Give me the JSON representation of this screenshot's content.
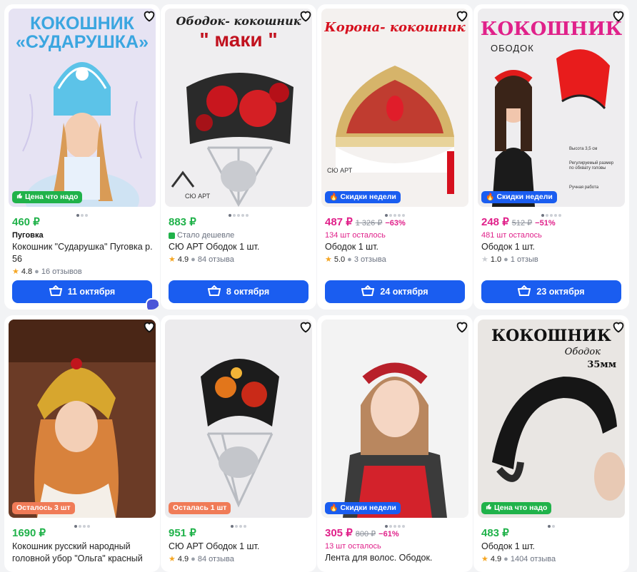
{
  "products": [
    {
      "badge": "Цена что надо",
      "badge_color": "#20b24a",
      "badge_icon": "thumb-up-icon",
      "price": "460 ₽",
      "old_price": "",
      "discount": "",
      "price_color": "#20b24a",
      "sub": "Пуговка",
      "sub_type": "bold",
      "title": "Кокошник \"Сударушка\" Пуговка р. 56",
      "rating": "4.8",
      "reviews": "16 отзывов",
      "delivery": "11 октября",
      "image": {
        "headline": "КОКОШНИК «СУДАРУШКА»",
        "headline_color": "#3ba6e0",
        "bg": "#e6e3f3"
      }
    },
    {
      "badge": "",
      "badge_color": "",
      "badge_icon": "",
      "price": "883 ₽",
      "old_price": "",
      "discount": "",
      "price_color": "#20b24a",
      "sub": "Стало дешевле",
      "sub_type": "gray",
      "title": "СЮ АРТ Ободок 1 шт.",
      "rating": "4.9",
      "reviews": "84 отзыва",
      "delivery": "8 октября",
      "image": {
        "headline": "Ободок- кокошник",
        "headline2": "\" маки \"",
        "headline_color": "#c1121f",
        "bg": "#efeef0",
        "brand": "СЮ АРТ"
      }
    },
    {
      "badge": "Скидки недели",
      "badge_color": "#1a5df0",
      "badge_icon": "fire-icon",
      "price": "487 ₽",
      "old_price": "1 326 ₽",
      "discount": "−63%",
      "price_color": "#e0218a",
      "sub": "134 шт осталось",
      "sub_type": "pink",
      "title": "Ободок 1 шт.",
      "rating": "5.0",
      "reviews": "3 отзыва",
      "delivery": "24 октября",
      "image": {
        "headline": "Корона- кокошник",
        "headline_color": "#d6101e",
        "bg": "#f4f1ef",
        "brand": "СЮ АРТ"
      }
    },
    {
      "badge": "Скидки недели",
      "badge_color": "#1a5df0",
      "badge_icon": "fire-icon",
      "price": "248 ₽",
      "old_price": "512 ₽",
      "discount": "−51%",
      "price_color": "#e0218a",
      "sub": "481 шт осталось",
      "sub_type": "pink",
      "title": "Ободок 1 шт.",
      "rating": "1.0",
      "reviews": "1 отзыв",
      "delivery": "23 октября",
      "image": {
        "headline": "КОКОШНИК",
        "headline2": "ОБОДОК",
        "headline_color": "#e0218a",
        "bg": "#eeedef",
        "spec1": "Высота 3,5 см",
        "spec2": "Регулируемый размер по обхвату головы",
        "spec3": "Ручная работа"
      }
    },
    {
      "badge": "Осталось 3 шт",
      "badge_color": "#f07b57",
      "badge_icon": "",
      "price": "1690 ₽",
      "old_price": "",
      "discount": "",
      "price_color": "#20b24a",
      "sub": "",
      "sub_type": "",
      "title": "Кокошник русский народный головной убор \"Ольга\" красный",
      "rating": "",
      "reviews": "",
      "delivery": "",
      "image": {
        "bg": "#6b3b26"
      }
    },
    {
      "badge": "Осталась 1 шт",
      "badge_color": "#f07b57",
      "badge_icon": "",
      "price": "951 ₽",
      "old_price": "",
      "discount": "",
      "price_color": "#20b24a",
      "sub": "",
      "sub_type": "",
      "title": "СЮ АРТ Ободок 1 шт.",
      "rating": "4.9",
      "reviews": "84 отзыва",
      "delivery": "",
      "image": {
        "bg": "#ecebed"
      }
    },
    {
      "badge": "Скидки недели",
      "badge_color": "#1a5df0",
      "badge_icon": "fire-icon",
      "price": "305 ₽",
      "old_price": "800 ₽",
      "discount": "−61%",
      "price_color": "#e0218a",
      "sub": "13 шт осталось",
      "sub_type": "pink",
      "title": "Лента для волос. Ободок.",
      "rating": "",
      "reviews": "",
      "delivery": "",
      "image": {
        "bg": "#f3f3f3"
      }
    },
    {
      "badge": "Цена что надо",
      "badge_color": "#20b24a",
      "badge_icon": "thumb-up-icon",
      "price": "483 ₽",
      "old_price": "",
      "discount": "",
      "price_color": "#20b24a",
      "sub": "",
      "sub_type": "",
      "title": "Ободок 1 шт.",
      "rating": "4.9",
      "reviews": "1404 отзыва",
      "delivery": "",
      "image": {
        "headline": "КОКОШНИК",
        "headline2": "Ободок",
        "headline3": "35мм",
        "headline_color": "#111",
        "bg": "#e9e6e3"
      }
    }
  ],
  "colors": {
    "accent": "#1a5df0",
    "green": "#20b24a",
    "pink": "#e0218a"
  }
}
